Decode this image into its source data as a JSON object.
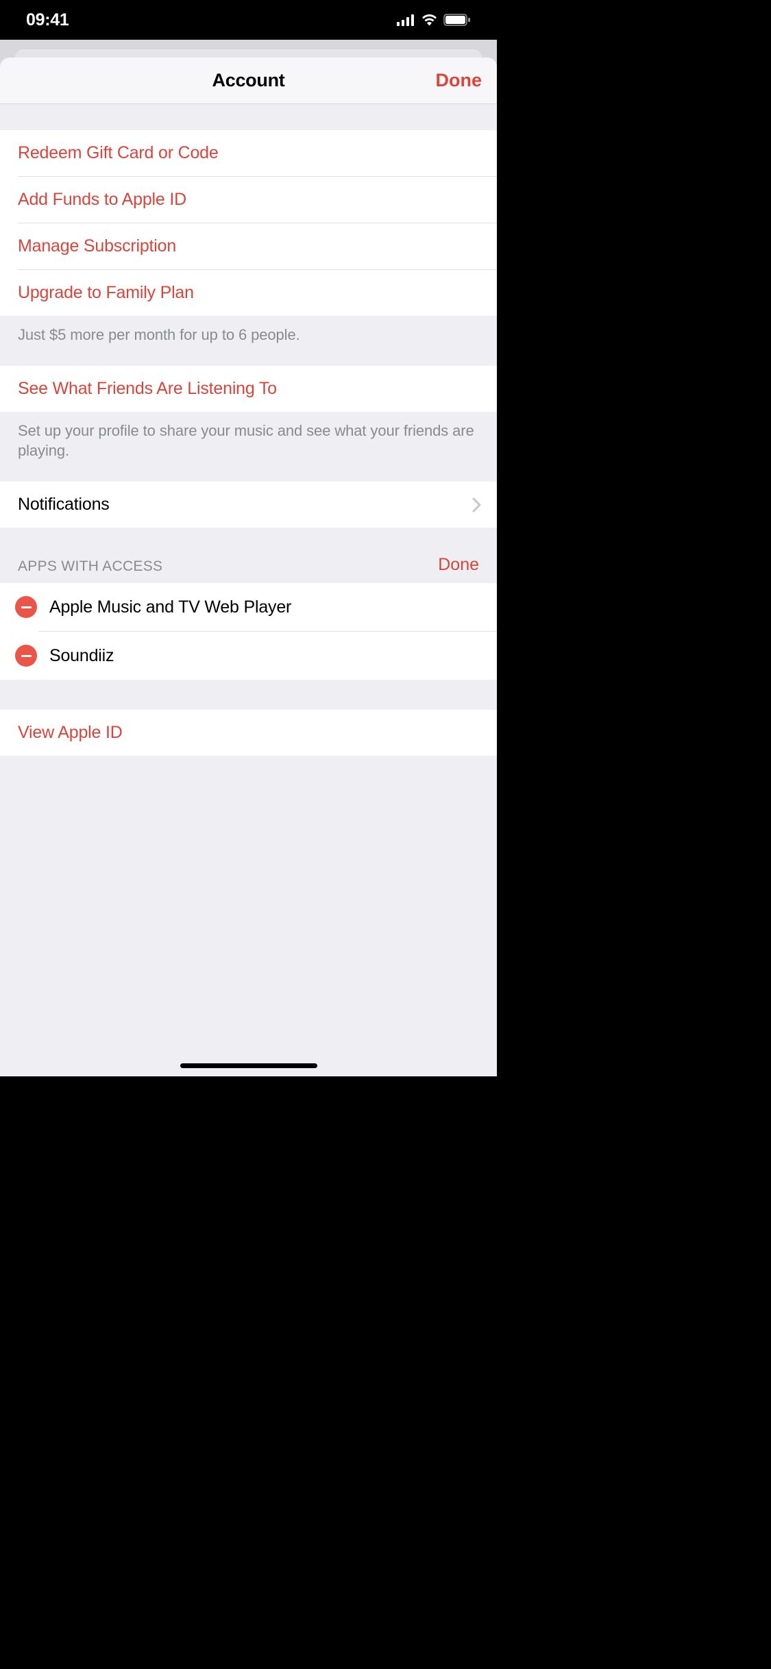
{
  "statusBar": {
    "time": "09:41"
  },
  "header": {
    "title": "Account",
    "doneLabel": "Done"
  },
  "section1": {
    "redeem": "Redeem Gift Card or Code",
    "addFunds": "Add Funds to Apple ID",
    "manageSubscription": "Manage Subscription",
    "upgradeFamily": "Upgrade to Family Plan",
    "upgradeFooter": "Just $5 more per month for up to 6 people."
  },
  "section2": {
    "friendsLabel": "See What Friends Are Listening To",
    "friendsFooter": "Set up your profile to share your music and see what your friends are playing."
  },
  "section3": {
    "notifications": "Notifications"
  },
  "appsAccess": {
    "header": "APPS WITH ACCESS",
    "doneLabel": "Done",
    "items": [
      {
        "name": "Apple Music and TV Web Player"
      },
      {
        "name": "Soundiiz"
      }
    ]
  },
  "section5": {
    "viewAppleId": "View Apple ID"
  }
}
